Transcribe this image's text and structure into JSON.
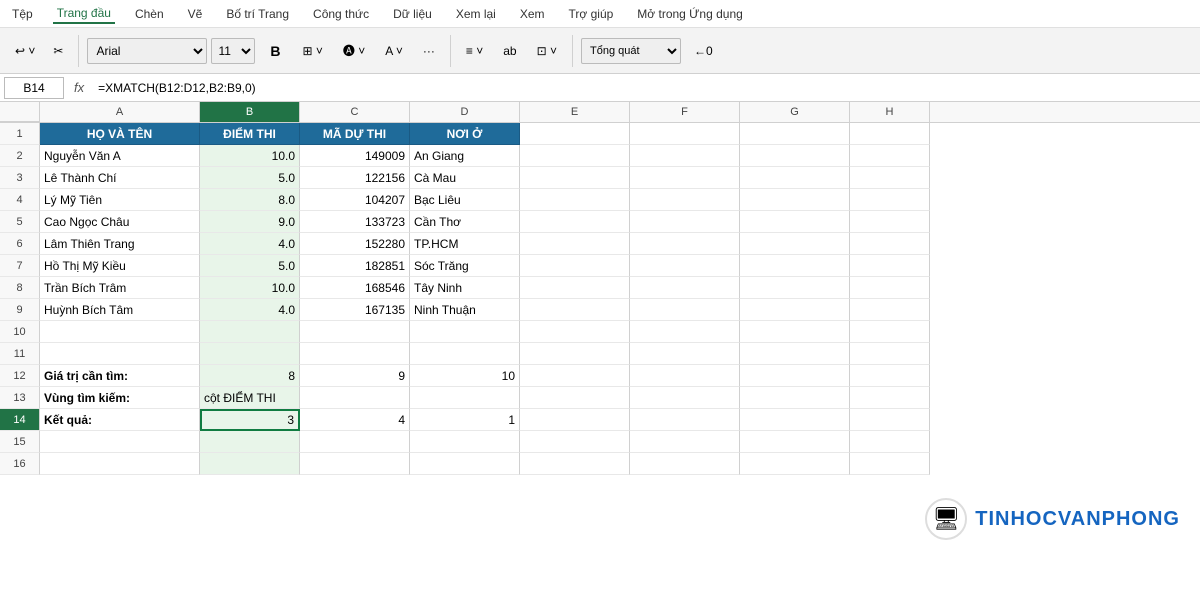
{
  "menu": {
    "items": [
      "Tệp",
      "Trang đầu",
      "Chèn",
      "Vẽ",
      "Bố trí Trang",
      "Công thức",
      "Dữ liệu",
      "Xem lại",
      "Xem",
      "Trợ giúp",
      "Mở trong Ứng dụng"
    ],
    "active": "Trang đầu"
  },
  "ribbon": {
    "undo_label": "↩",
    "redo_label": "↪",
    "font_name": "Arial",
    "font_size": "11",
    "bold_label": "B",
    "number_format": "Tổng quát"
  },
  "formula_bar": {
    "cell_ref": "B14",
    "fx_symbol": "fx",
    "formula": "=XMATCH(B12:D12,B2:B9,0)"
  },
  "columns": {
    "headers": [
      "A",
      "B",
      "C",
      "D",
      "E",
      "F",
      "G",
      "H"
    ],
    "row_header_width": 40
  },
  "rows": [
    {
      "num": 1,
      "cells": [
        {
          "col": "A",
          "value": "HỌ VÀ TÊN",
          "type": "header"
        },
        {
          "col": "B",
          "value": "ĐIỂM THI",
          "type": "header"
        },
        {
          "col": "C",
          "value": "MÃ DỰ THI",
          "type": "header"
        },
        {
          "col": "D",
          "value": "NƠI Ở",
          "type": "header"
        },
        {
          "col": "E",
          "value": "",
          "type": "normal"
        },
        {
          "col": "F",
          "value": "",
          "type": "normal"
        },
        {
          "col": "G",
          "value": "",
          "type": "normal"
        },
        {
          "col": "H",
          "value": "",
          "type": "normal"
        }
      ]
    },
    {
      "num": 2,
      "cells": [
        {
          "col": "A",
          "value": "Nguyễn Văn A",
          "type": "normal"
        },
        {
          "col": "B",
          "value": "10.0",
          "type": "right"
        },
        {
          "col": "C",
          "value": "149009",
          "type": "right"
        },
        {
          "col": "D",
          "value": "An Giang",
          "type": "normal"
        },
        {
          "col": "E",
          "value": "",
          "type": "normal"
        },
        {
          "col": "F",
          "value": "",
          "type": "normal"
        },
        {
          "col": "G",
          "value": "",
          "type": "normal"
        },
        {
          "col": "H",
          "value": "",
          "type": "normal"
        }
      ]
    },
    {
      "num": 3,
      "cells": [
        {
          "col": "A",
          "value": "Lê Thành Chí",
          "type": "normal"
        },
        {
          "col": "B",
          "value": "5.0",
          "type": "right"
        },
        {
          "col": "C",
          "value": "122156",
          "type": "right"
        },
        {
          "col": "D",
          "value": "Cà Mau",
          "type": "normal"
        },
        {
          "col": "E",
          "value": "",
          "type": "normal"
        },
        {
          "col": "F",
          "value": "",
          "type": "normal"
        },
        {
          "col": "G",
          "value": "",
          "type": "normal"
        },
        {
          "col": "H",
          "value": "",
          "type": "normal"
        }
      ]
    },
    {
      "num": 4,
      "cells": [
        {
          "col": "A",
          "value": "Lý Mỹ Tiên",
          "type": "normal"
        },
        {
          "col": "B",
          "value": "8.0",
          "type": "right"
        },
        {
          "col": "C",
          "value": "104207",
          "type": "right"
        },
        {
          "col": "D",
          "value": "Bạc Liêu",
          "type": "normal"
        },
        {
          "col": "E",
          "value": "",
          "type": "normal"
        },
        {
          "col": "F",
          "value": "",
          "type": "normal"
        },
        {
          "col": "G",
          "value": "",
          "type": "normal"
        },
        {
          "col": "H",
          "value": "",
          "type": "normal"
        }
      ]
    },
    {
      "num": 5,
      "cells": [
        {
          "col": "A",
          "value": "Cao Ngọc Châu",
          "type": "normal"
        },
        {
          "col": "B",
          "value": "9.0",
          "type": "right"
        },
        {
          "col": "C",
          "value": "133723",
          "type": "right"
        },
        {
          "col": "D",
          "value": "Cần Thơ",
          "type": "normal"
        },
        {
          "col": "E",
          "value": "",
          "type": "normal"
        },
        {
          "col": "F",
          "value": "",
          "type": "normal"
        },
        {
          "col": "G",
          "value": "",
          "type": "normal"
        },
        {
          "col": "H",
          "value": "",
          "type": "normal"
        }
      ]
    },
    {
      "num": 6,
      "cells": [
        {
          "col": "A",
          "value": "Lâm Thiên Trang",
          "type": "normal"
        },
        {
          "col": "B",
          "value": "4.0",
          "type": "right"
        },
        {
          "col": "C",
          "value": "152280",
          "type": "right"
        },
        {
          "col": "D",
          "value": "TP.HCM",
          "type": "normal"
        },
        {
          "col": "E",
          "value": "",
          "type": "normal"
        },
        {
          "col": "F",
          "value": "",
          "type": "normal"
        },
        {
          "col": "G",
          "value": "",
          "type": "normal"
        },
        {
          "col": "H",
          "value": "",
          "type": "normal"
        }
      ]
    },
    {
      "num": 7,
      "cells": [
        {
          "col": "A",
          "value": "Hồ Thị Mỹ Kiều",
          "type": "normal"
        },
        {
          "col": "B",
          "value": "5.0",
          "type": "right"
        },
        {
          "col": "C",
          "value": "182851",
          "type": "right"
        },
        {
          "col": "D",
          "value": "Sóc Trăng",
          "type": "normal"
        },
        {
          "col": "E",
          "value": "",
          "type": "normal"
        },
        {
          "col": "F",
          "value": "",
          "type": "normal"
        },
        {
          "col": "G",
          "value": "",
          "type": "normal"
        },
        {
          "col": "H",
          "value": "",
          "type": "normal"
        }
      ]
    },
    {
      "num": 8,
      "cells": [
        {
          "col": "A",
          "value": "Trần Bích Trâm",
          "type": "normal"
        },
        {
          "col": "B",
          "value": "10.0",
          "type": "right"
        },
        {
          "col": "C",
          "value": "168546",
          "type": "right"
        },
        {
          "col": "D",
          "value": "Tây Ninh",
          "type": "normal"
        },
        {
          "col": "E",
          "value": "",
          "type": "normal"
        },
        {
          "col": "F",
          "value": "",
          "type": "normal"
        },
        {
          "col": "G",
          "value": "",
          "type": "normal"
        },
        {
          "col": "H",
          "value": "",
          "type": "normal"
        }
      ]
    },
    {
      "num": 9,
      "cells": [
        {
          "col": "A",
          "value": "Huỳnh Bích Tâm",
          "type": "normal"
        },
        {
          "col": "B",
          "value": "4.0",
          "type": "right"
        },
        {
          "col": "C",
          "value": "167135",
          "type": "right"
        },
        {
          "col": "D",
          "value": "Ninh Thuận",
          "type": "normal"
        },
        {
          "col": "E",
          "value": "",
          "type": "normal"
        },
        {
          "col": "F",
          "value": "",
          "type": "normal"
        },
        {
          "col": "G",
          "value": "",
          "type": "normal"
        },
        {
          "col": "H",
          "value": "",
          "type": "normal"
        }
      ]
    },
    {
      "num": 10,
      "cells": [
        {
          "col": "A",
          "value": "",
          "type": "normal"
        },
        {
          "col": "B",
          "value": "",
          "type": "normal"
        },
        {
          "col": "C",
          "value": "",
          "type": "normal"
        },
        {
          "col": "D",
          "value": "",
          "type": "normal"
        },
        {
          "col": "E",
          "value": "",
          "type": "normal"
        },
        {
          "col": "F",
          "value": "",
          "type": "normal"
        },
        {
          "col": "G",
          "value": "",
          "type": "normal"
        },
        {
          "col": "H",
          "value": "",
          "type": "normal"
        }
      ]
    },
    {
      "num": 11,
      "cells": [
        {
          "col": "A",
          "value": "",
          "type": "normal"
        },
        {
          "col": "B",
          "value": "",
          "type": "normal"
        },
        {
          "col": "C",
          "value": "",
          "type": "normal"
        },
        {
          "col": "D",
          "value": "",
          "type": "normal"
        },
        {
          "col": "E",
          "value": "",
          "type": "normal"
        },
        {
          "col": "F",
          "value": "",
          "type": "normal"
        },
        {
          "col": "G",
          "value": "",
          "type": "normal"
        },
        {
          "col": "H",
          "value": "",
          "type": "normal"
        }
      ]
    },
    {
      "num": 12,
      "cells": [
        {
          "col": "A",
          "value": "Giá trị cần tìm:",
          "type": "bold"
        },
        {
          "col": "B",
          "value": "8",
          "type": "right"
        },
        {
          "col": "C",
          "value": "9",
          "type": "right"
        },
        {
          "col": "D",
          "value": "10",
          "type": "right"
        },
        {
          "col": "E",
          "value": "",
          "type": "normal"
        },
        {
          "col": "F",
          "value": "",
          "type": "normal"
        },
        {
          "col": "G",
          "value": "",
          "type": "normal"
        },
        {
          "col": "H",
          "value": "",
          "type": "normal"
        }
      ]
    },
    {
      "num": 13,
      "cells": [
        {
          "col": "A",
          "value": "Vùng tìm kiếm:",
          "type": "bold"
        },
        {
          "col": "B",
          "value": "cột ĐIỂM THI",
          "type": "normal"
        },
        {
          "col": "C",
          "value": "",
          "type": "normal"
        },
        {
          "col": "D",
          "value": "",
          "type": "normal"
        },
        {
          "col": "E",
          "value": "",
          "type": "normal"
        },
        {
          "col": "F",
          "value": "",
          "type": "normal"
        },
        {
          "col": "G",
          "value": "",
          "type": "normal"
        },
        {
          "col": "H",
          "value": "",
          "type": "normal"
        }
      ]
    },
    {
      "num": 14,
      "cells": [
        {
          "col": "A",
          "value": "Kết quả:",
          "type": "bold"
        },
        {
          "col": "B",
          "value": "3",
          "type": "right-active"
        },
        {
          "col": "C",
          "value": "4",
          "type": "right"
        },
        {
          "col": "D",
          "value": "1",
          "type": "right"
        },
        {
          "col": "E",
          "value": "",
          "type": "normal"
        },
        {
          "col": "F",
          "value": "",
          "type": "normal"
        },
        {
          "col": "G",
          "value": "",
          "type": "normal"
        },
        {
          "col": "H",
          "value": "",
          "type": "normal"
        }
      ]
    },
    {
      "num": 15,
      "cells": [
        {
          "col": "A",
          "value": "",
          "type": "normal"
        },
        {
          "col": "B",
          "value": "",
          "type": "normal"
        },
        {
          "col": "C",
          "value": "",
          "type": "normal"
        },
        {
          "col": "D",
          "value": "",
          "type": "normal"
        },
        {
          "col": "E",
          "value": "",
          "type": "normal"
        },
        {
          "col": "F",
          "value": "",
          "type": "normal"
        },
        {
          "col": "G",
          "value": "",
          "type": "normal"
        },
        {
          "col": "H",
          "value": "",
          "type": "normal"
        }
      ]
    },
    {
      "num": 16,
      "cells": [
        {
          "col": "A",
          "value": "",
          "type": "normal"
        },
        {
          "col": "B",
          "value": "",
          "type": "normal"
        },
        {
          "col": "C",
          "value": "",
          "type": "normal"
        },
        {
          "col": "D",
          "value": "",
          "type": "normal"
        },
        {
          "col": "E",
          "value": "",
          "type": "normal"
        },
        {
          "col": "F",
          "value": "",
          "type": "normal"
        },
        {
          "col": "G",
          "value": "",
          "type": "normal"
        },
        {
          "col": "H",
          "value": "",
          "type": "normal"
        }
      ]
    }
  ],
  "watermark": {
    "logo_text": "🖥",
    "brand_text": "TINHOCVANPHONG",
    "brand_color": "#1565c0"
  }
}
